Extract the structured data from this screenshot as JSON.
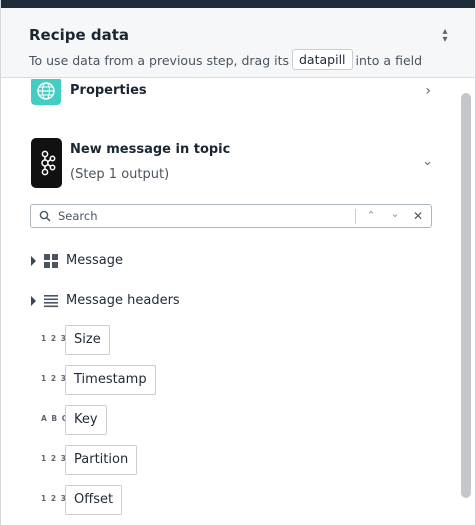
{
  "header": {
    "title": "Recipe data",
    "subtitle_before": "To use data from a previous step, drag its",
    "subtitle_pill": "datapill",
    "subtitle_after": "into a field"
  },
  "steps": {
    "properties": {
      "title": "Properties",
      "icon": "properties-globe-icon",
      "color": "#43cdc3"
    },
    "trigger": {
      "title": "New message in topic",
      "subtitle": "(Step 1 output)",
      "icon": "kafka-icon",
      "color": "#111111"
    }
  },
  "search": {
    "placeholder": "Search",
    "value": ""
  },
  "tree": [
    {
      "label": "Message",
      "icon": "grid-icon"
    },
    {
      "label": "Message headers",
      "icon": "list-icon"
    }
  ],
  "fields": [
    {
      "type": "1 2 3",
      "label": "Size"
    },
    {
      "type": "1 2 3",
      "label": "Timestamp"
    },
    {
      "type": "A B C",
      "label": "Key"
    },
    {
      "type": "1 2 3",
      "label": "Partition"
    },
    {
      "type": "1 2 3",
      "label": "Offset"
    }
  ],
  "colors": {
    "topbar": "#1f2d3a",
    "header_bg": "#f6f7f8",
    "scrollbar": "#c3c7cb"
  }
}
